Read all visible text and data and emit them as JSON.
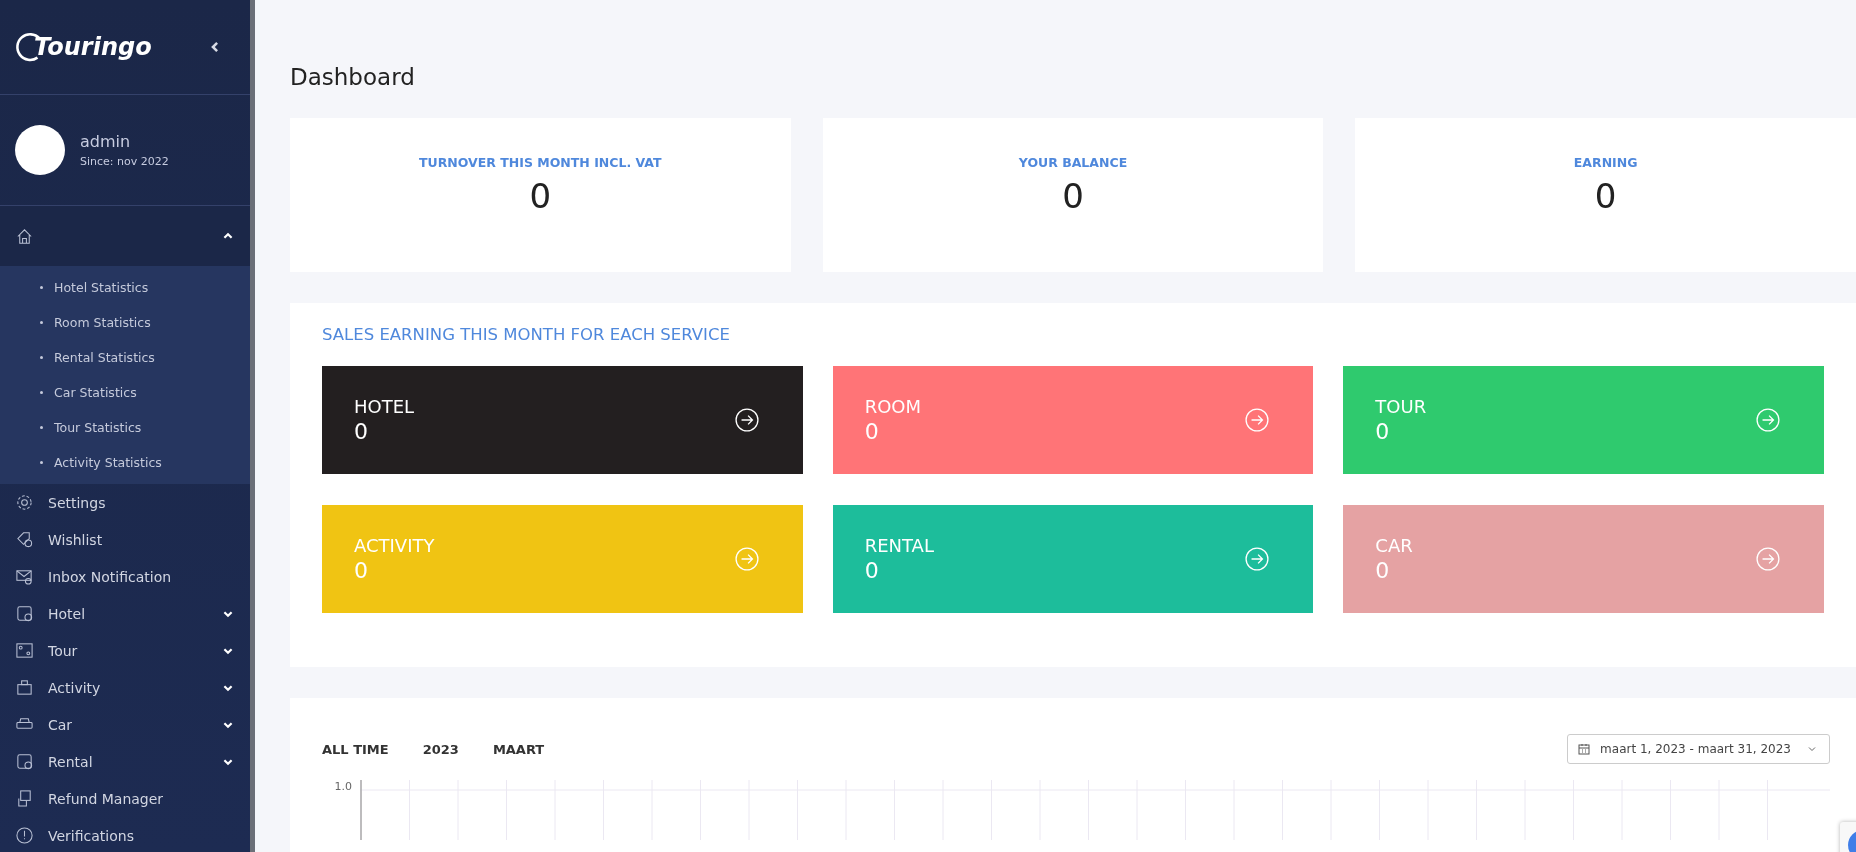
{
  "sidebar": {
    "logo": "Touringo",
    "user": {
      "name": "admin",
      "since": "Since: nov 2022"
    },
    "menu": [
      {
        "expanded": true,
        "children": [
          {
            "label": "Hotel Statistics"
          },
          {
            "label": "Room Statistics"
          },
          {
            "label": "Rental Statistics"
          },
          {
            "label": "Car Statistics"
          },
          {
            "label": "Tour Statistics"
          },
          {
            "label": "Activity Statistics"
          }
        ]
      },
      {
        "label": "Settings"
      },
      {
        "label": "Wishlist"
      },
      {
        "label": "Inbox Notification"
      },
      {
        "label": "Hotel",
        "expanded": false
      },
      {
        "label": "Tour",
        "expanded": false
      },
      {
        "label": "Activity",
        "expanded": false
      },
      {
        "label": "Car",
        "expanded": false
      },
      {
        "label": "Rental",
        "expanded": false
      },
      {
        "label": "Refund Manager"
      },
      {
        "label": "Verifications"
      }
    ]
  },
  "page_title": "Dashboard",
  "stats": [
    {
      "label": "TURNOVER THIS MONTH INCL. VAT",
      "value": "0"
    },
    {
      "label": "YOUR BALANCE",
      "value": "0"
    },
    {
      "label": "EARNING",
      "value": "0"
    }
  ],
  "sales": {
    "title": "SALES EARNING THIS MONTH FOR EACH SERVICE",
    "tiles": [
      {
        "name": "HOTEL",
        "value": "0",
        "color": "#231f20"
      },
      {
        "name": "ROOM",
        "value": "0",
        "color": "#ff7477"
      },
      {
        "name": "TOUR",
        "value": "0",
        "color": "#2fca6e"
      },
      {
        "name": "ACTIVITY",
        "value": "0",
        "color": "#f0c413"
      },
      {
        "name": "RENTAL",
        "value": "0",
        "color": "#1dbd9b"
      },
      {
        "name": "CAR",
        "value": "0",
        "color": "#e5a2a3"
      }
    ]
  },
  "chart_panel": {
    "tabs": [
      "ALL TIME",
      "2023",
      "MAART"
    ],
    "date_range": "maart 1, 2023 - maart 31, 2023",
    "y_tick": "1.0"
  }
}
